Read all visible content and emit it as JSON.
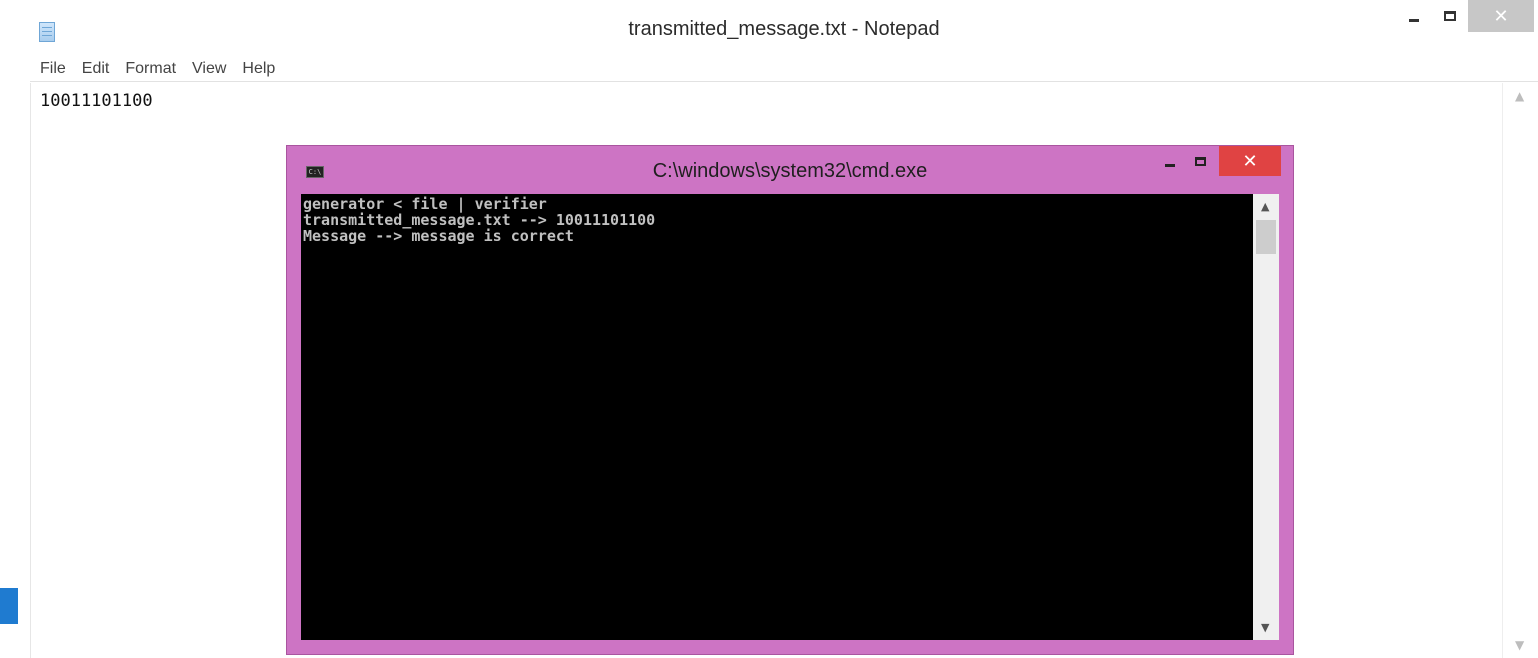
{
  "notepad": {
    "title": "transmitted_message.txt - Notepad",
    "menu": [
      "File",
      "Edit",
      "Format",
      "View",
      "Help"
    ],
    "content": "10011101100",
    "controls": {
      "minimize": "–",
      "maximize": "☐",
      "close": "✕"
    },
    "scroll": {
      "up": "▲",
      "down": "▼"
    }
  },
  "cmd": {
    "title": "C:\\windows\\system32\\cmd.exe",
    "icon_text": "C:\\",
    "lines": [
      "generator < file | verifier",
      "transmitted_message.txt --> 10011101100",
      "Message --> message is correct"
    ],
    "controls": {
      "minimize": "–",
      "maximize": "☐",
      "close": "✕"
    },
    "scroll": {
      "up": "▲",
      "down": "▼"
    }
  },
  "colors": {
    "cmd_frame": "#cd74c4",
    "cmd_close": "#e04343",
    "console_bg": "#000000",
    "console_text": "#c0c0c0"
  }
}
